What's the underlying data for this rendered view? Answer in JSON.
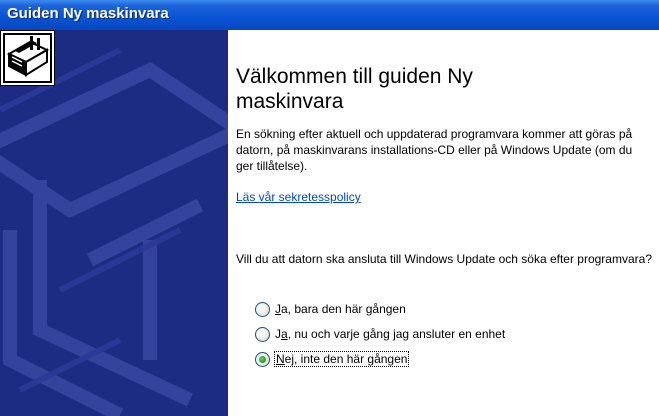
{
  "window": {
    "title": "Guiden Ny maskinvara"
  },
  "colors": {
    "titlebar": "#0a54d6",
    "side_panel": "#1c2c83",
    "link": "#0046d5",
    "radio_checked": "#21a121"
  },
  "icons": {
    "wizard": "hardware-wizard-icon"
  },
  "content": {
    "heading": "Välkommen till guiden Ny maskinvara",
    "description": "En sökning efter aktuell och uppdaterad programvara kommer att göras på datorn, på maskinvarans installations-CD eller på Windows Update (om du ger tillåtelse).",
    "privacy_link": "Läs vår sekretesspolicy",
    "question": "Vill du att datorn ska ansluta till Windows Update och söka efter programvara?",
    "options": [
      {
        "pre": "",
        "key": "J",
        "post": "a, bara den här gången",
        "checked": false
      },
      {
        "pre": "J",
        "key": "a",
        "post": ", nu och varje gång jag ansluter en enhet",
        "checked": false
      },
      {
        "pre": "",
        "key": "N",
        "post": "ej, inte den här gången",
        "checked": true
      }
    ]
  }
}
